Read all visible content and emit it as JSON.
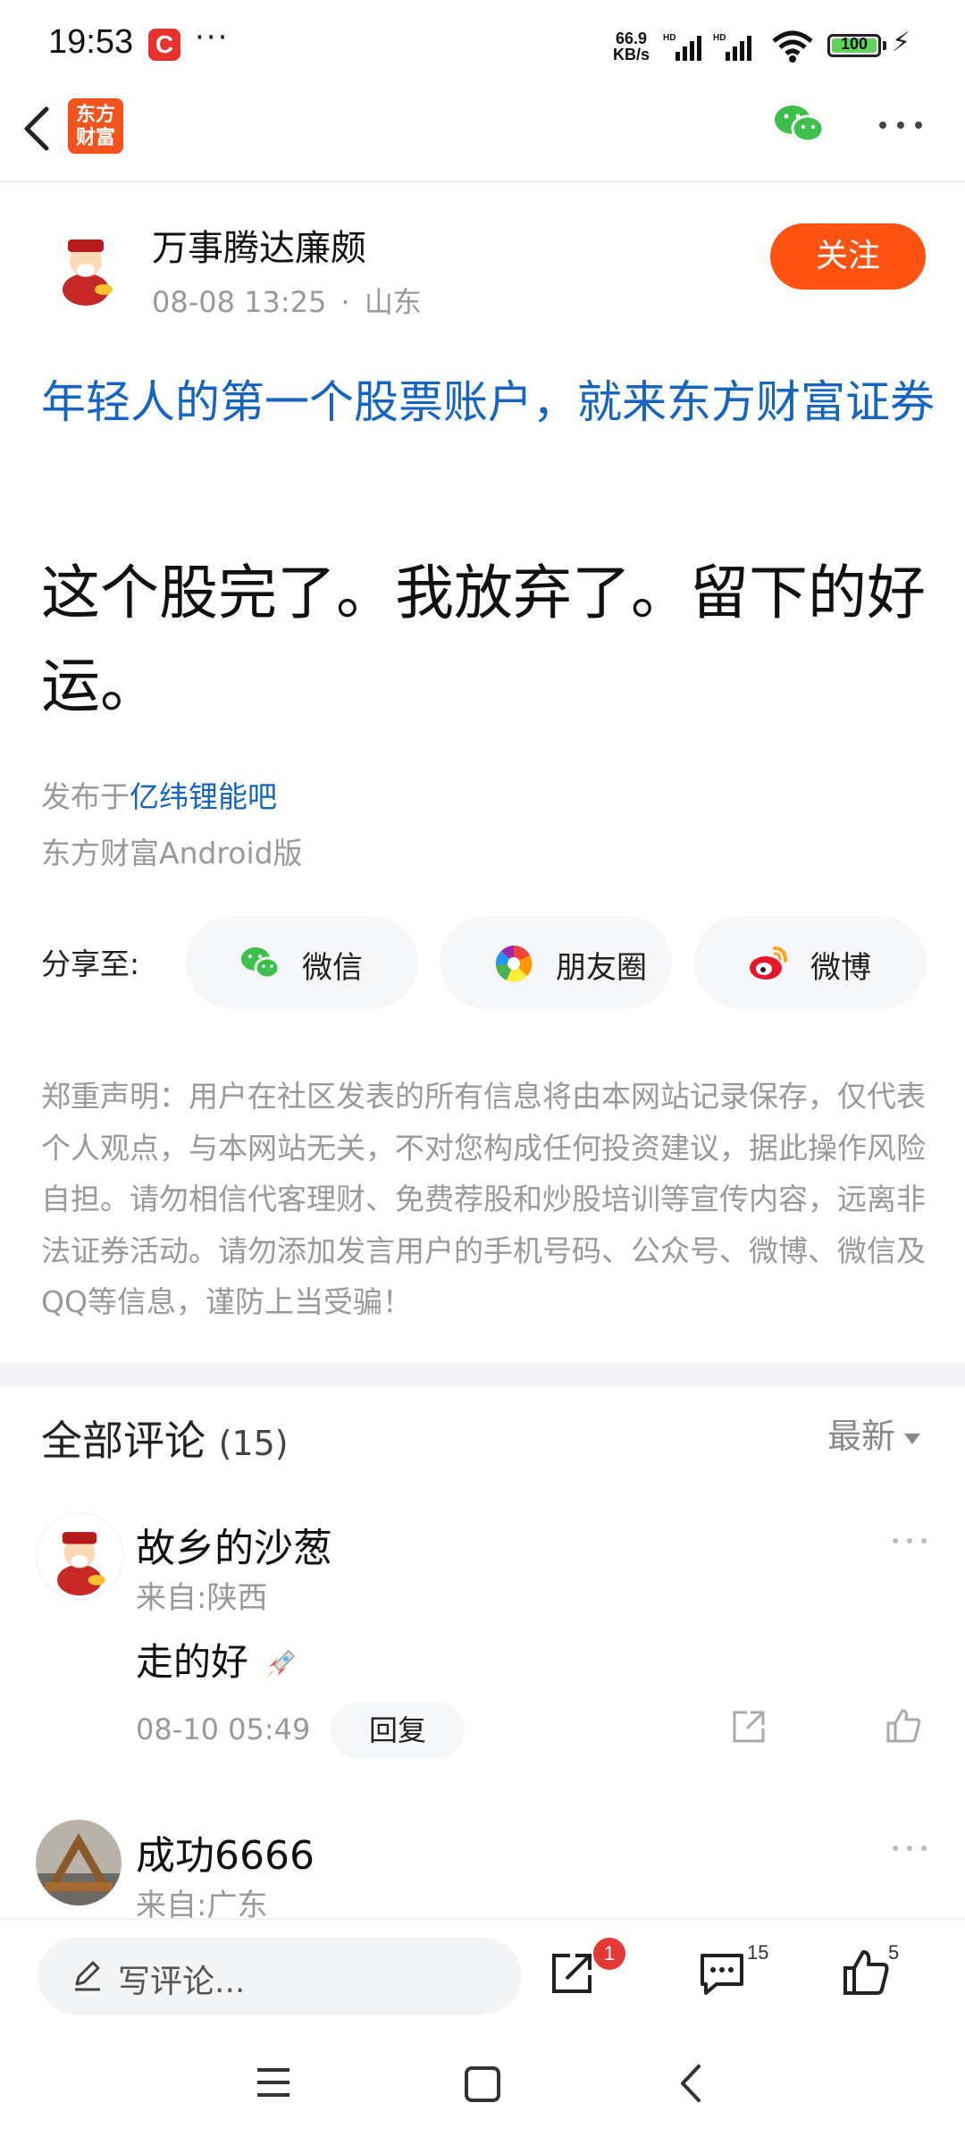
{
  "status_bar": {
    "time": "19:53",
    "app_badge": "C",
    "dots": "···",
    "net_speed_value": "66.9",
    "net_speed_unit": "KB/s",
    "hd1": "HD",
    "hd2": "HD",
    "battery": "100"
  },
  "nav": {
    "logo_line1": "东方",
    "logo_line2": "财富"
  },
  "author": {
    "name": "万事腾达廉颇",
    "time": "08-08 13:25",
    "location": "山东",
    "follow_label": "关注"
  },
  "post": {
    "ad_link": "年轻人的第一个股票账户，就来东方财富证券",
    "title": "这个股完了。我放弃了。留下的好运。",
    "published_prefix": "发布于",
    "published_bar": "亿纬锂能吧",
    "client": "东方财富Android版"
  },
  "share": {
    "label": "分享至:",
    "wechat": "微信",
    "moments": "朋友圈",
    "weibo": "微博"
  },
  "disclaimer": "郑重声明：用户在社区发表的所有信息将由本网站记录保存，仅代表个人观点，与本网站无关，不对您构成任何投资建议，据此操作风险自担。请勿相信代客理财、免费荐股和炒股培训等宣传内容，远离非法证券活动。请勿添加发言用户的手机号码、公众号、微博、微信及QQ等信息，谨防上当受骗！",
  "comments": {
    "title": "全部评论",
    "count": "(15)",
    "sort": "最新",
    "items": [
      {
        "name": "故乡的沙葱",
        "from": "来自:陕西",
        "text": "走的好",
        "time": "08-10 05:49",
        "reply": "回复"
      },
      {
        "name": "成功6666",
        "from": "来自:广东"
      }
    ]
  },
  "bottom_bar": {
    "placeholder": "写评论...",
    "share_badge": "1",
    "comment_count": "15",
    "like_count": "5"
  },
  "colors": {
    "accent": "#ff5313",
    "link": "#1565c0",
    "badge": "#e53935"
  }
}
